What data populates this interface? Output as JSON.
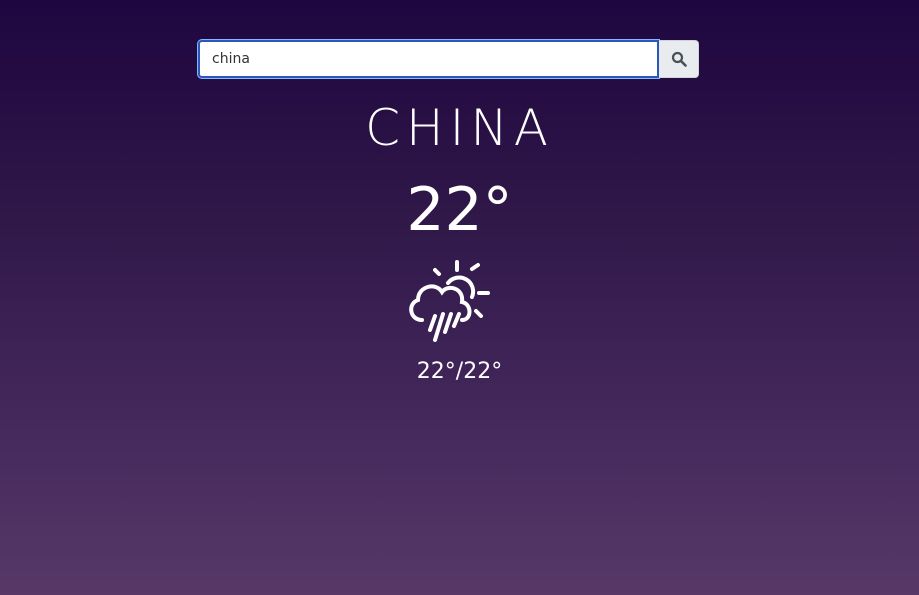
{
  "search": {
    "value": "china",
    "button_icon": "search-icon"
  },
  "weather": {
    "city": "CHINA",
    "temperature": "22°",
    "condition_icon": "sun-cloud-rain-icon",
    "min_max": "22°/22°"
  },
  "colors": {
    "background_top": "#1e0640",
    "background_bottom": "#573867",
    "text": "#ffffff",
    "input_border": "#2a58b8",
    "button_background": "#e9ecef"
  }
}
